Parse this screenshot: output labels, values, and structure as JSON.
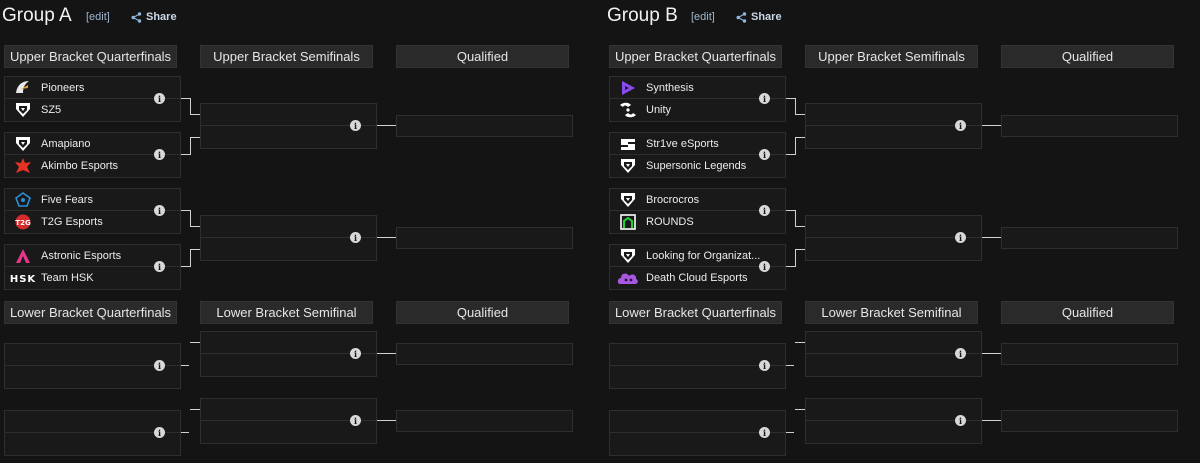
{
  "groups": [
    {
      "title": "Group A",
      "edit": "[edit]",
      "share": "Share",
      "upper_headers": [
        "Upper Bracket Quarterfinals",
        "Upper Bracket Semifinals",
        "Qualified"
      ],
      "lower_headers": [
        "Lower Bracket Quarterfinals",
        "Lower Bracket Semifinal",
        "Qualified"
      ],
      "teams": [
        "Pioneers",
        "SZ5",
        "Amapiano",
        "Akimbo Esports",
        "Five Fears",
        "T2G Esports",
        "Astronic Esports",
        "Team HSK"
      ],
      "logos": [
        "pioneers-icon",
        "rocket-league-icon",
        "rocket-league-icon",
        "akimbo-icon",
        "five-fears-icon",
        "t2g-icon",
        "astronic-icon",
        "hsk-icon"
      ]
    },
    {
      "title": "Group B",
      "edit": "[edit]",
      "share": "Share",
      "upper_headers": [
        "Upper Bracket Quarterfinals",
        "Upper Bracket Semifinals",
        "Qualified"
      ],
      "lower_headers": [
        "Lower Bracket Quarterfinals",
        "Lower Bracket Semifinal",
        "Qualified"
      ],
      "teams": [
        "Synthesis",
        "Unity",
        "Str1ve eSports",
        "Supersonic Legends",
        "Brocrocros",
        "ROUNDS",
        "Looking for Organizat...",
        "Death Cloud Esports"
      ],
      "logos": [
        "synthesis-icon",
        "unity-icon",
        "strive-icon",
        "rocket-league-icon",
        "rocket-league-icon",
        "rounds-icon",
        "rocket-league-icon",
        "death-cloud-icon"
      ]
    }
  ],
  "colors": {
    "background": "#141414",
    "header": "#2a2a2a",
    "slot": "#191919",
    "connector": "#d0d0d0"
  }
}
